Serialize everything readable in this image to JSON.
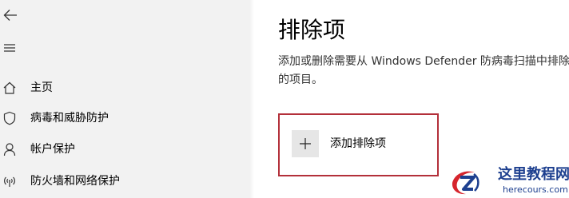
{
  "sidebar": {
    "items": [
      {
        "label": "主页",
        "icon": "home-icon"
      },
      {
        "label": "病毒和威胁防护",
        "icon": "shield-icon"
      },
      {
        "label": "帐户保护",
        "icon": "person-icon"
      },
      {
        "label": "防火墙和网络保护",
        "icon": "wifi-icon"
      }
    ]
  },
  "main": {
    "title": "排除项",
    "description": "添加或删除需要从 Windows Defender 防病毒扫描中排除的项目。",
    "add_button_label": "添加排除项"
  },
  "watermark": {
    "title": "这里教程网",
    "url": "herecours.com"
  },
  "colors": {
    "sidebar_bg": "#f2f2f2",
    "highlight_border": "#b3303a",
    "button_bg": "#e6e6e6",
    "watermark_blue": "#1d3f8f"
  }
}
